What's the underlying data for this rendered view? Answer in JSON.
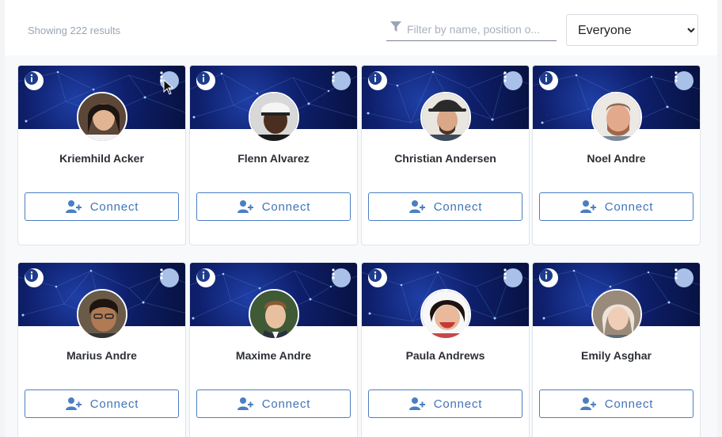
{
  "results": {
    "count_label": "Showing 222 results"
  },
  "filter": {
    "placeholder": "Filter by name, position o..."
  },
  "audience_select": {
    "selected": "Everyone"
  },
  "colors": {
    "accent": "#3f74b8",
    "banner": "#0e1f6b",
    "more_button": "#a9c0e8"
  },
  "icons": {
    "info": "info-icon",
    "more": "more-vertical-icon",
    "connect": "add-user-icon",
    "filter": "filter-icon"
  },
  "people": [
    {
      "name": "Kriemhild Acker",
      "action": "Connect"
    },
    {
      "name": "Flenn Alvarez",
      "action": "Connect"
    },
    {
      "name": "Christian Andersen",
      "action": "Connect"
    },
    {
      "name": "Noel Andre",
      "action": "Connect"
    },
    {
      "name": "Marius Andre",
      "action": "Connect"
    },
    {
      "name": "Maxime Andre",
      "action": "Connect"
    },
    {
      "name": "Paula Andrews",
      "action": "Connect"
    },
    {
      "name": "Emily Asghar",
      "action": "Connect"
    }
  ]
}
